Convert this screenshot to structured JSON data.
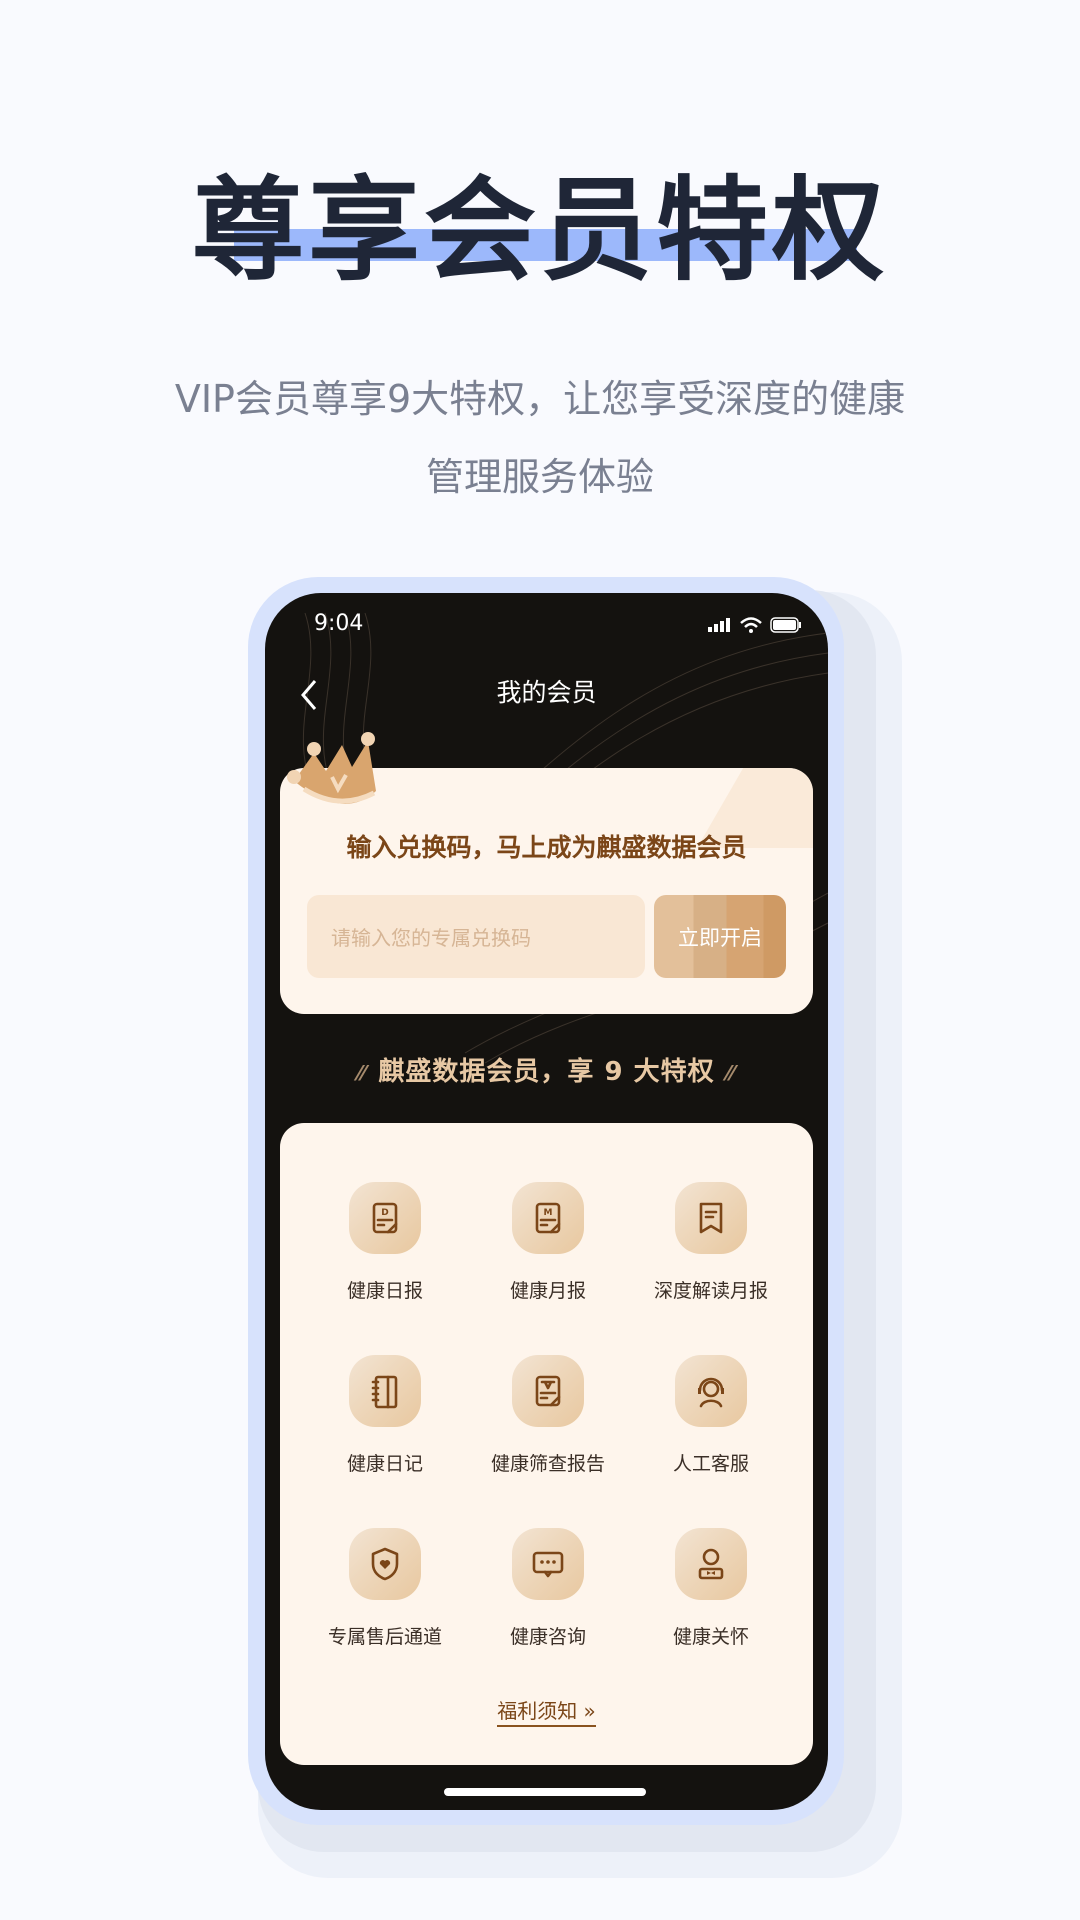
{
  "hero": {
    "title": "尊享会员特权",
    "subtitle_line1": "VIP会员尊享9大特权，让您享受深度的健康",
    "subtitle_line2": "管理服务体验",
    "highlight_color": "#9cb8fb"
  },
  "phone": {
    "status": {
      "time": "9:04"
    },
    "nav": {
      "title": "我的会员",
      "back_icon": "chevron-left-icon"
    },
    "redeem": {
      "title": "输入兑换码，马上成为麒盛数据会员",
      "placeholder": "请输入您的专属兑换码",
      "button": "立即开启"
    },
    "caption": {
      "quote_left": "⁄⁄",
      "text": "麒盛数据会员，享 9 大特权",
      "quote_right": "⁄⁄"
    },
    "benefits": [
      {
        "label": "健康日报",
        "icon": "daily-report-icon"
      },
      {
        "label": "健康月报",
        "icon": "monthly-report-icon"
      },
      {
        "label": "深度解读月报",
        "icon": "bookmark-report-icon"
      },
      {
        "label": "健康日记",
        "icon": "notebook-icon"
      },
      {
        "label": "健康筛查报告",
        "icon": "screening-report-icon"
      },
      {
        "label": "人工客服",
        "icon": "headset-agent-icon"
      },
      {
        "label": "专属售后通道",
        "icon": "shield-heart-icon"
      },
      {
        "label": "健康咨询",
        "icon": "chat-bubble-icon"
      },
      {
        "label": "健康关怀",
        "icon": "person-bowtie-icon"
      }
    ],
    "notice": "福利须知 »",
    "colors": {
      "accent": "#7b4618",
      "card": "#fef5ec",
      "screen": "#14120f"
    }
  }
}
